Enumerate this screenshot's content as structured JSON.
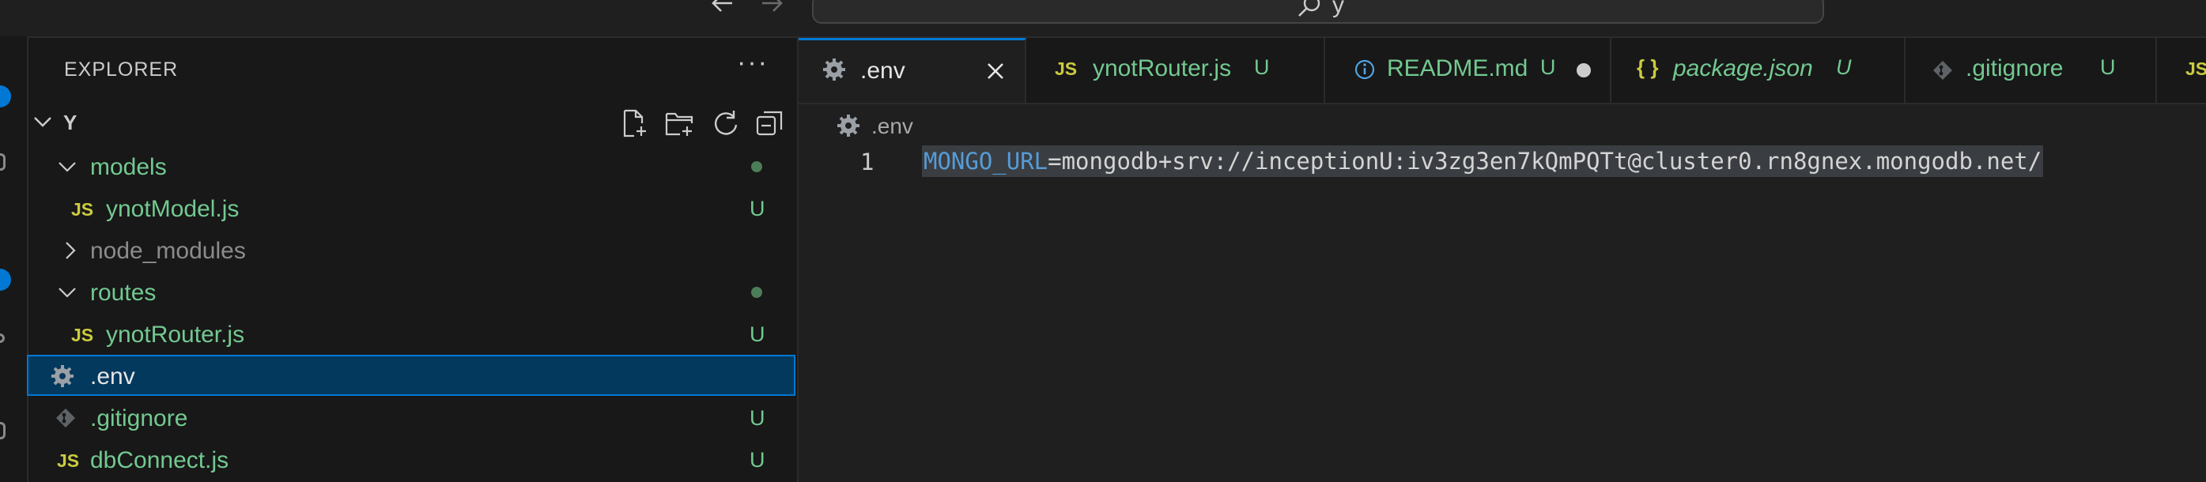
{
  "titlebar": {
    "back_icon": "arrow-left-icon",
    "forward_icon": "arrow-right-icon",
    "search_text": "y"
  },
  "sidebar": {
    "title": "EXPLORER",
    "more_actions": "···",
    "root": {
      "label": "Y",
      "tools": [
        "new-file-icon",
        "new-folder-icon",
        "refresh-icon",
        "collapse-all-icon"
      ]
    },
    "tree": [
      {
        "label": "models",
        "type": "folder",
        "expanded": true,
        "status": "dot"
      },
      {
        "label": "ynotModel.js",
        "type": "js",
        "status": "U"
      },
      {
        "label": "node_modules",
        "type": "folder",
        "expanded": false,
        "status": ""
      },
      {
        "label": "routes",
        "type": "folder",
        "expanded": true,
        "status": "dot"
      },
      {
        "label": "ynotRouter.js",
        "type": "js",
        "status": "U"
      },
      {
        "label": ".env",
        "type": "gear",
        "status": "",
        "selected": true
      },
      {
        "label": ".gitignore",
        "type": "git",
        "status": "U"
      },
      {
        "label": "dbConnect.js",
        "type": "js",
        "status": "U"
      }
    ]
  },
  "tabs": [
    {
      "label": ".env",
      "icon": "gear-icon",
      "active": true,
      "close": "close-icon"
    },
    {
      "label": "ynotRouter.js",
      "icon": "js-icon",
      "status": "U"
    },
    {
      "label": "README.md",
      "icon": "info-icon",
      "status": "U",
      "modified": true
    },
    {
      "label": "package.json",
      "icon": "braces-icon",
      "status": "U",
      "italic": true
    },
    {
      "label": ".gitignore",
      "icon": "git-icon",
      "status": "U"
    }
  ],
  "icons": {
    "js_label": "JS",
    "braces_label": "{ }"
  },
  "editor": {
    "breadcrumb": ".env",
    "line_number": "1",
    "code_key": "MONGO_URL",
    "code_value": "=mongodb+srv://inceptionU:iv3zg3en7kQmPQTt@cluster0.rn8gnex.mongodb.net/"
  },
  "colors": {
    "accent": "#0078d4",
    "untracked": "#73c991",
    "js_icon": "#cbcb41",
    "selection": "#04395e",
    "editor_bg": "#1f1f1f",
    "sidebar_bg": "#181818"
  }
}
